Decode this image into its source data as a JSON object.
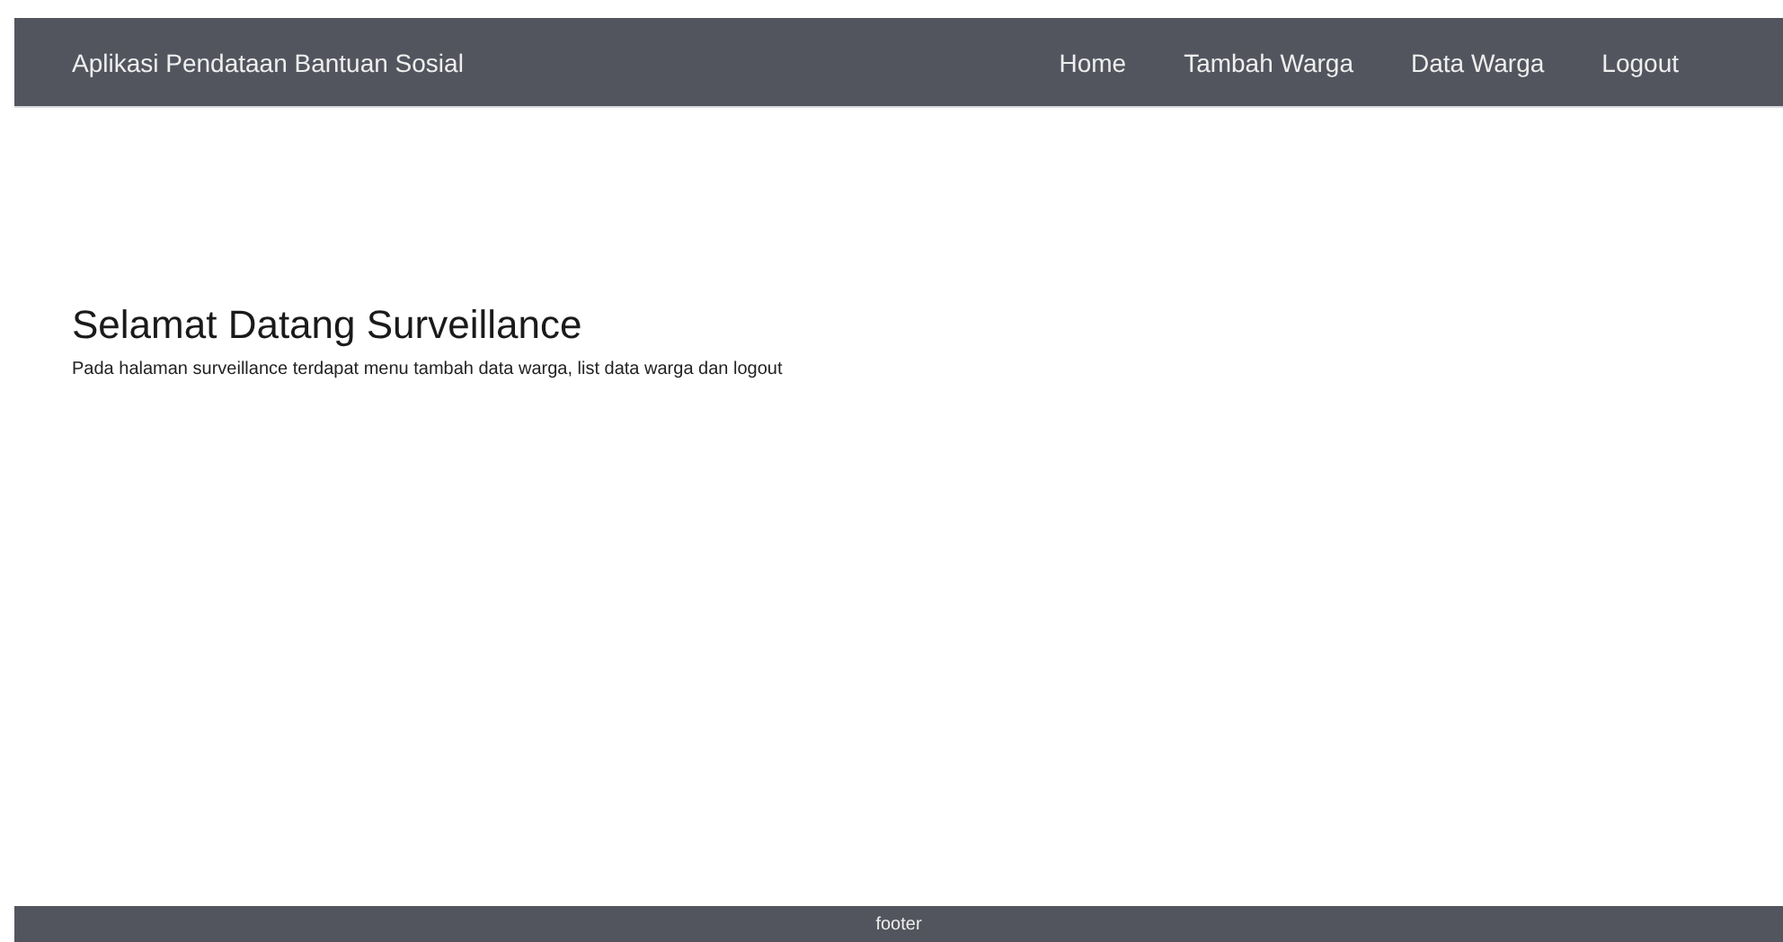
{
  "navbar": {
    "brand": "Aplikasi Pendataan Bantuan Sosial",
    "links": [
      {
        "label": "Home"
      },
      {
        "label": "Tambah Warga"
      },
      {
        "label": "Data Warga"
      },
      {
        "label": "Logout"
      }
    ]
  },
  "content": {
    "heading": "Selamat Datang Surveillance",
    "text": "Pada halaman surveillance terdapat menu tambah data warga, list data warga dan logout"
  },
  "footer": {
    "text": "footer"
  }
}
